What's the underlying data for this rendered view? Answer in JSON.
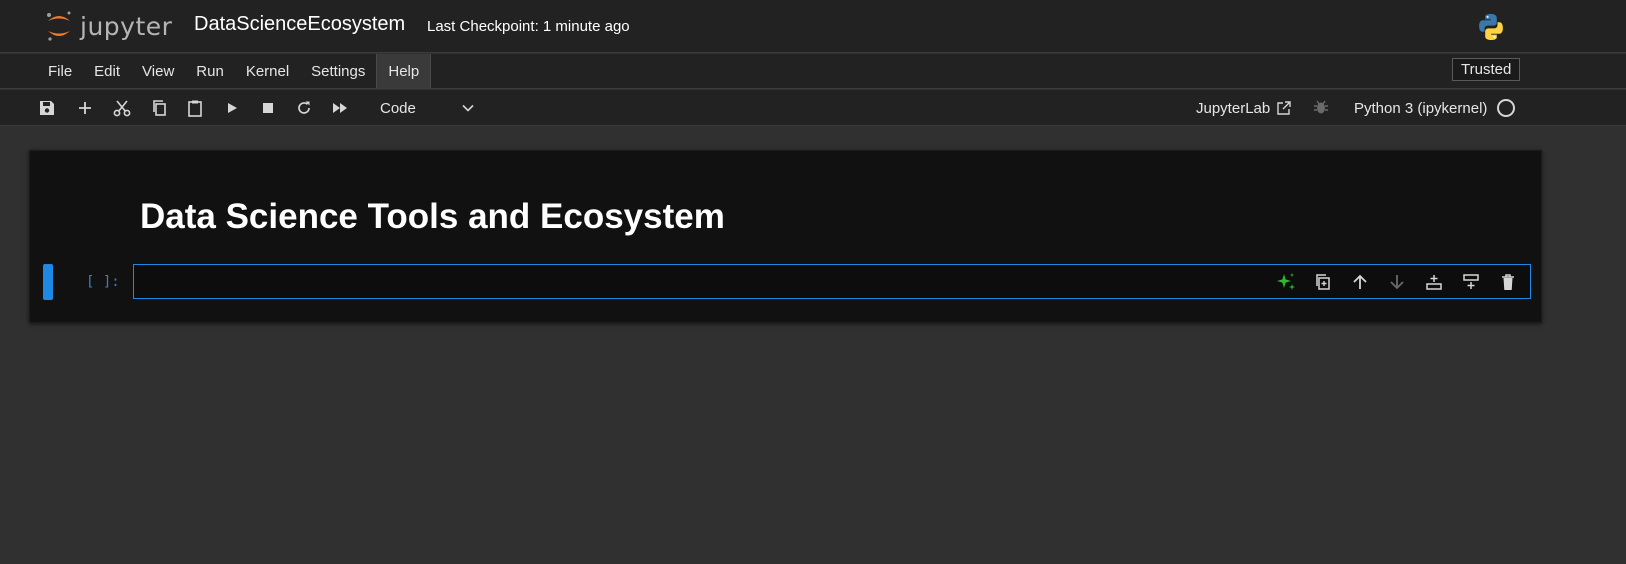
{
  "header": {
    "logo_text": "jupyter",
    "notebook_title": "DataScienceEcosystem",
    "checkpoint": "Last Checkpoint: 1 minute ago"
  },
  "menubar": {
    "items": [
      "File",
      "Edit",
      "View",
      "Run",
      "Kernel",
      "Settings",
      "Help"
    ],
    "active": "Help",
    "trusted_label": "Trusted"
  },
  "toolbar": {
    "cell_type": "Code",
    "jupyterlab_label": "JupyterLab",
    "kernel_name": "Python 3 (ipykernel)"
  },
  "notebook": {
    "heading": "Data Science Tools and Ecosystem",
    "code_cell_prompt": "[ ]:",
    "code_cell_value": ""
  },
  "colors": {
    "accent": "#1e88e5",
    "ai_icon": "#2eb82e",
    "logo_orange": "#f37726"
  }
}
